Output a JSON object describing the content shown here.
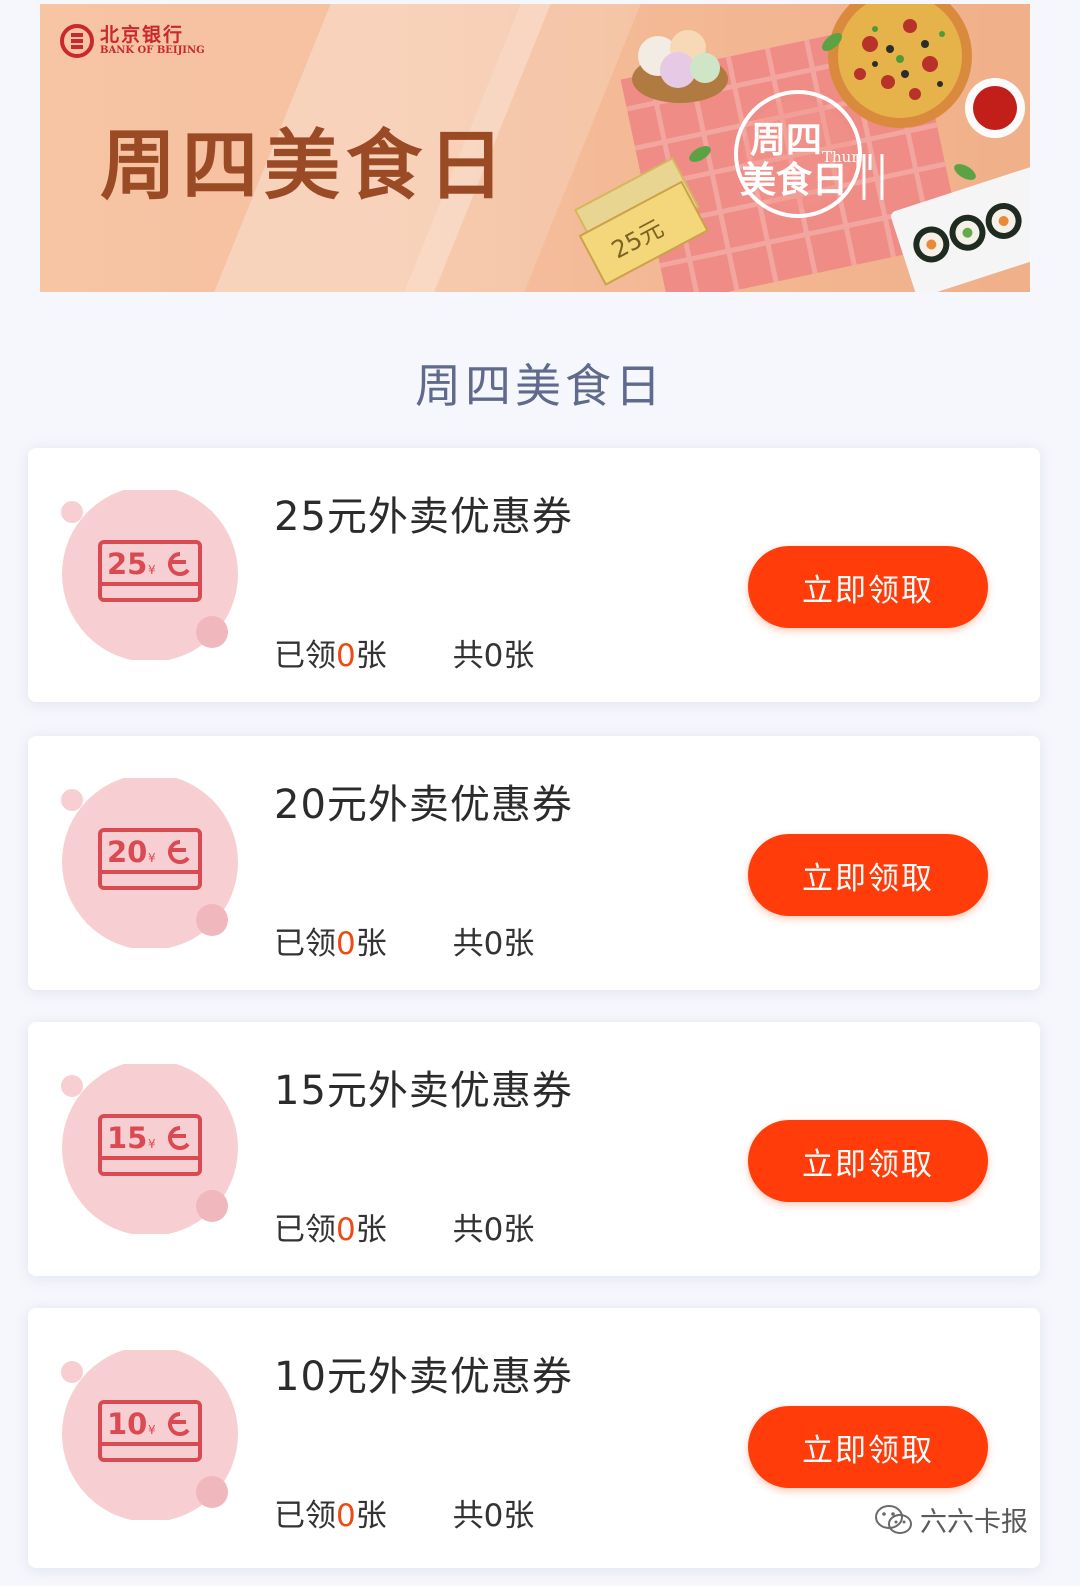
{
  "banner": {
    "bank_name_cn": "北京银行",
    "bank_name_en": "BANK OF BEIJING",
    "title": "周四美食日",
    "badge_line1": "周四",
    "badge_line2": "美食日",
    "badge_en": "Thur",
    "ticket_text": "25元"
  },
  "section_title": "周四美食日",
  "coupons": [
    {
      "title": "25元外卖优惠券",
      "amount": "25",
      "claimed_prefix": "已领",
      "claimed_count": "0",
      "claimed_unit": "张",
      "total": "共0张",
      "button": "立即领取"
    },
    {
      "title": "20元外卖优惠券",
      "amount": "20",
      "claimed_prefix": "已领",
      "claimed_count": "0",
      "claimed_unit": "张",
      "total": "共0张",
      "button": "立即领取"
    },
    {
      "title": "15元外卖优惠券",
      "amount": "15",
      "claimed_prefix": "已领",
      "claimed_count": "0",
      "claimed_unit": "张",
      "total": "共0张",
      "button": "立即领取"
    },
    {
      "title": "10元外卖优惠券",
      "amount": "10",
      "claimed_prefix": "已领",
      "claimed_count": "0",
      "claimed_unit": "张",
      "total": "共0张",
      "button": "立即领取"
    }
  ],
  "watermark": "六六卡报",
  "colors": {
    "accent": "#ff3c0a",
    "highlight": "#f04a14",
    "title": "#5f6a8c",
    "banner_title": "#9a4b26"
  }
}
